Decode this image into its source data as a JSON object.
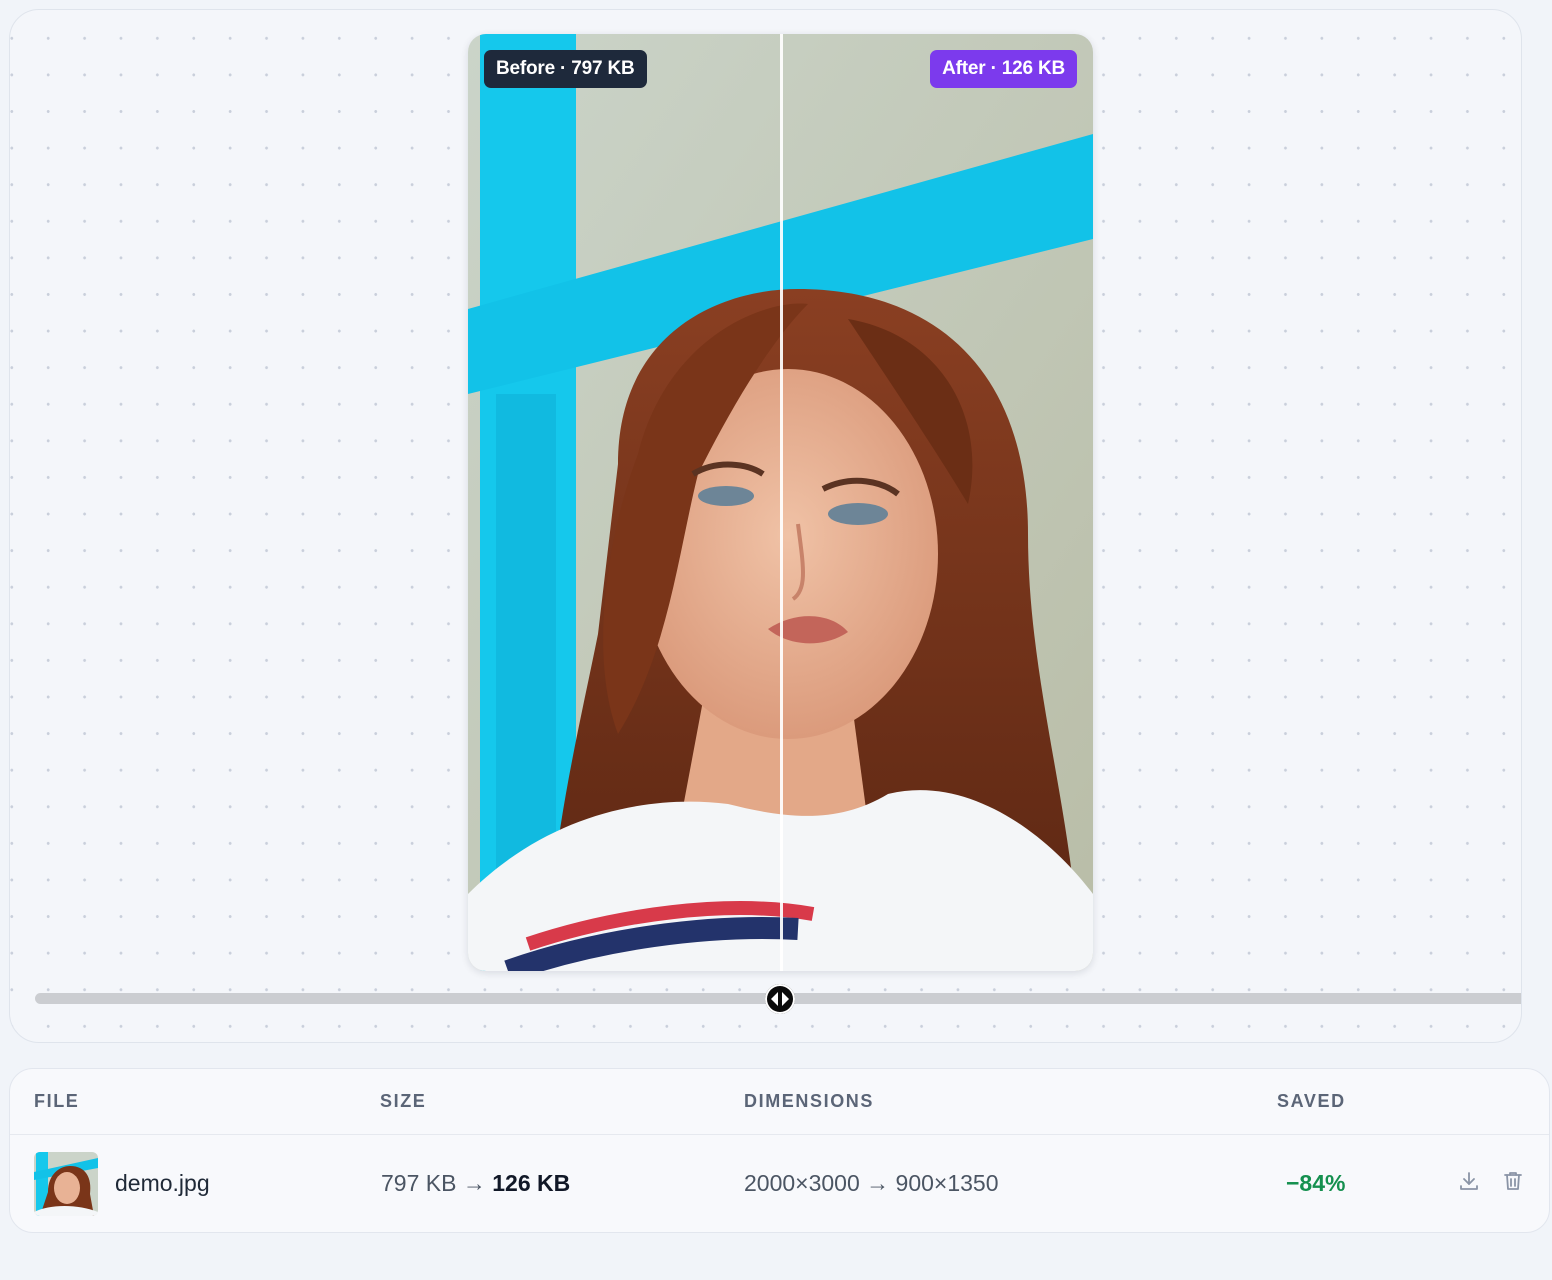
{
  "compare": {
    "before_badge": "Before · 797 KB",
    "after_badge": "After · 126 KB",
    "slider_position_percent": 50,
    "before_color": "#1e293b",
    "after_color": "#7c3aed"
  },
  "table": {
    "headers": {
      "file": "FILE",
      "size": "SIZE",
      "dimensions": "DIMENSIONS",
      "saved": "SAVED"
    },
    "rows": [
      {
        "file_name": "demo.jpg",
        "size_before": "797 KB →",
        "size_after": "126 KB",
        "dimensions": "2000×3000 → 900×1350",
        "saved": "−84%",
        "saved_color": "#15904f",
        "actions": [
          "download-icon",
          "trash-icon"
        ]
      }
    ]
  }
}
